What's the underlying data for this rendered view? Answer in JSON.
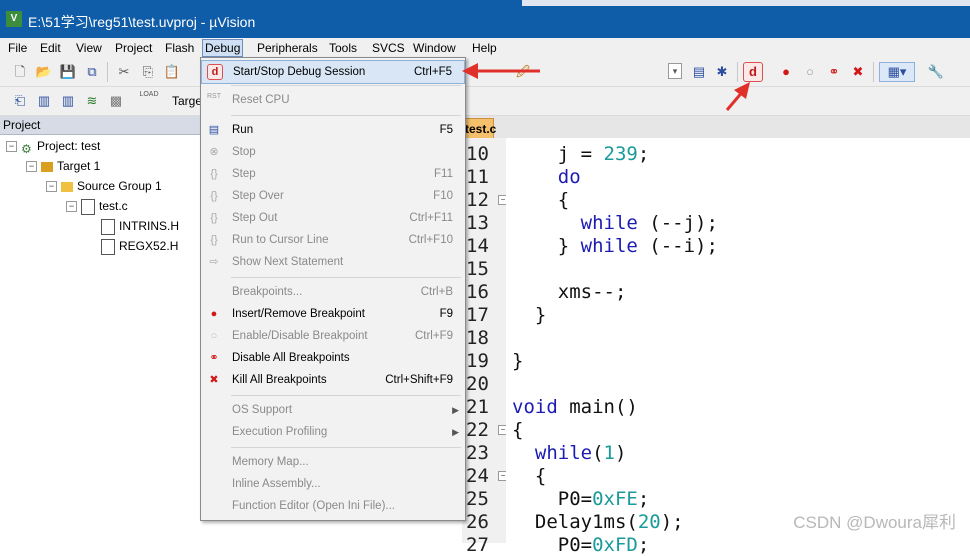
{
  "window": {
    "title": "E:\\51学习\\reg51\\test.uvproj - µVision"
  },
  "menubar": [
    "File",
    "Edit",
    "View",
    "Project",
    "Flash",
    "Debug",
    "Peripherals",
    "Tools",
    "SVCS",
    "Window",
    "Help"
  ],
  "toolbar": {
    "target_label": "Target",
    "load_label": "LOAD"
  },
  "project": {
    "header": "Project",
    "tree": [
      {
        "label": "Project: test"
      },
      {
        "label": "Target 1"
      },
      {
        "label": "Source Group 1"
      },
      {
        "label": "test.c"
      },
      {
        "label": "INTRINS.H"
      },
      {
        "label": "REGX52.H"
      }
    ]
  },
  "editor": {
    "tab": "test.c",
    "line_numbers": [
      "10",
      "11",
      "12",
      "13",
      "14",
      "15",
      "16",
      "17",
      "18",
      "19",
      "20",
      "21",
      "22",
      "23",
      "24",
      "25",
      "26",
      "27"
    ]
  },
  "debug_menu": [
    {
      "label": "Start/Stop Debug Session",
      "shortcut": "Ctrl+F5",
      "icon": "debug-session-icon",
      "disabled": false,
      "highlighted": true
    },
    {
      "label": "Reset CPU",
      "shortcut": "",
      "icon": "reset-cpu-icon",
      "disabled": true
    },
    {
      "label": "Run",
      "shortcut": "F5",
      "icon": "run-icon",
      "disabled": false
    },
    {
      "label": "Stop",
      "shortcut": "",
      "icon": "stop-icon",
      "disabled": true
    },
    {
      "label": "Step",
      "shortcut": "F11",
      "icon": "step-icon",
      "disabled": true
    },
    {
      "label": "Step Over",
      "shortcut": "F10",
      "icon": "step-over-icon",
      "disabled": true
    },
    {
      "label": "Step Out",
      "shortcut": "Ctrl+F11",
      "icon": "step-out-icon",
      "disabled": true
    },
    {
      "label": "Run to Cursor Line",
      "shortcut": "Ctrl+F10",
      "icon": "run-to-cursor-icon",
      "disabled": true
    },
    {
      "label": "Show Next Statement",
      "shortcut": "",
      "icon": "show-next-icon",
      "disabled": true
    },
    {
      "label": "Breakpoints...",
      "shortcut": "Ctrl+B",
      "icon": "",
      "disabled": true
    },
    {
      "label": "Insert/Remove Breakpoint",
      "shortcut": "F9",
      "icon": "breakpoint-icon",
      "disabled": false
    },
    {
      "label": "Enable/Disable Breakpoint",
      "shortcut": "Ctrl+F9",
      "icon": "enable-breakpoint-icon",
      "disabled": true
    },
    {
      "label": "Disable All Breakpoints",
      "shortcut": "",
      "icon": "disable-all-breakpoints-icon",
      "disabled": false
    },
    {
      "label": "Kill All Breakpoints",
      "shortcut": "Ctrl+Shift+F9",
      "icon": "kill-breakpoints-icon",
      "disabled": false
    },
    {
      "label": "OS Support",
      "shortcut": "",
      "icon": "",
      "disabled": true,
      "submenu": true
    },
    {
      "label": "Execution Profiling",
      "shortcut": "",
      "icon": "",
      "disabled": true,
      "submenu": true
    },
    {
      "label": "Memory Map...",
      "shortcut": "",
      "icon": "",
      "disabled": true
    },
    {
      "label": "Inline Assembly...",
      "shortcut": "",
      "icon": "",
      "disabled": true
    },
    {
      "label": "Function Editor (Open Ini File)...",
      "shortcut": "",
      "icon": "",
      "disabled": true
    }
  ],
  "watermark": "CSDN @Dwoura犀利",
  "colors": {
    "title_bar": "#0f5ca8",
    "keyword": "#1c1cb4",
    "number": "#1a9a9a",
    "arrow": "#e0302a"
  }
}
